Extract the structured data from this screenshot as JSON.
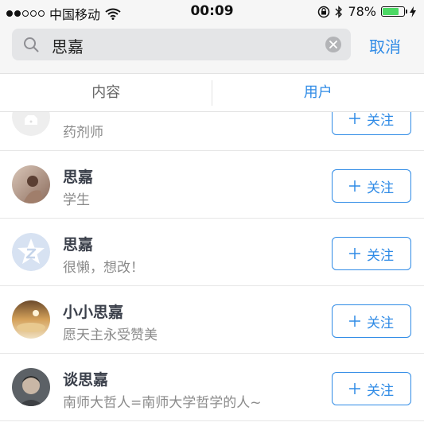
{
  "status_bar": {
    "carrier": "中国移动",
    "time": "00:09",
    "battery_percent": "78%",
    "battery_level": 0.78,
    "battery_color": "#4cd964"
  },
  "search": {
    "query": "思嘉",
    "cancel_label": "取消"
  },
  "tabs": [
    {
      "label": "内容",
      "active": false
    },
    {
      "label": "用户",
      "active": true
    }
  ],
  "accent_color": "#2f8be6",
  "users": [
    {
      "name": "",
      "desc": "药剂师",
      "follow_label": "关注",
      "avatar": "default-avatar"
    },
    {
      "name": "思嘉",
      "desc": "学生",
      "follow_label": "关注",
      "avatar": "photo-avatar"
    },
    {
      "name": "思嘉",
      "desc": "很懒，想改！",
      "follow_label": "关注",
      "avatar": "default-z-avatar"
    },
    {
      "name": "小小思嘉",
      "desc": "愿天主永受赞美",
      "follow_label": "关注",
      "avatar": "photo-avatar"
    },
    {
      "name": "谈思嘉",
      "desc": "南师大哲人=南师大学哲学的人~",
      "follow_label": "关注",
      "avatar": "photo-avatar"
    }
  ]
}
